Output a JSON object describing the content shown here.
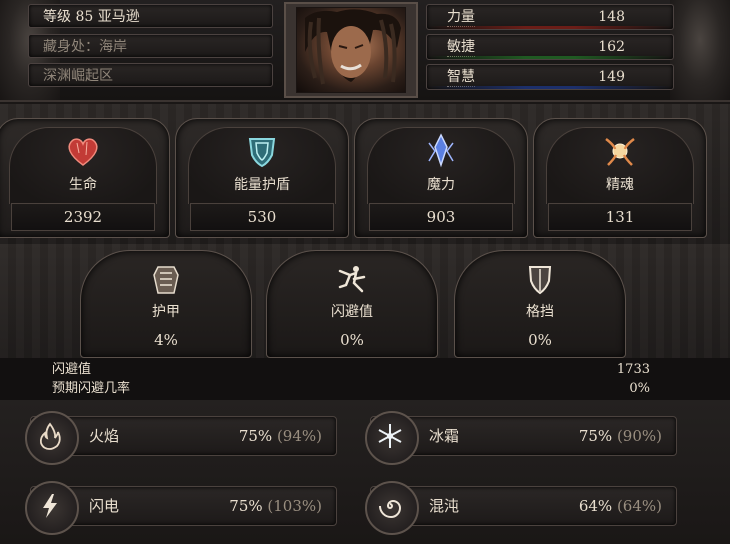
{
  "header": {
    "level_line": "等级 85 亚马逊",
    "hideout_line": "藏身处：海岸",
    "league_line": "深渊崛起区"
  },
  "attributes": [
    {
      "name": "力量",
      "value": "148",
      "bar_color": "#6b1d17"
    },
    {
      "name": "敏捷",
      "value": "162",
      "bar_color": "#1f5a22"
    },
    {
      "name": "智慧",
      "value": "149",
      "bar_color": "#1c2f6b"
    }
  ],
  "resources": [
    {
      "label": "生命",
      "value": "2392",
      "icon": "heart-icon"
    },
    {
      "label": "能量护盾",
      "value": "530",
      "icon": "energy-shield-icon"
    },
    {
      "label": "魔力",
      "value": "903",
      "icon": "mana-crystal-icon"
    },
    {
      "label": "精魂",
      "value": "131",
      "icon": "spirit-orb-icon"
    }
  ],
  "defenses": [
    {
      "label": "护甲",
      "value": "4%",
      "icon": "armour-icon"
    },
    {
      "label": "闪避值",
      "value": "0%",
      "icon": "evasion-icon"
    },
    {
      "label": "格挡",
      "value": "0%",
      "icon": "block-shield-icon"
    }
  ],
  "evasion_details": [
    {
      "key": "闪避值",
      "value": "1733"
    },
    {
      "key": "预期闪避几率",
      "value": "0%"
    }
  ],
  "resistances": [
    {
      "name": "火焰",
      "value": "75%",
      "max": "(94%)",
      "icon": "fire-icon"
    },
    {
      "name": "冰霜",
      "value": "75%",
      "max": "(90%)",
      "icon": "snowflake-icon"
    },
    {
      "name": "闪电",
      "value": "75%",
      "max": "(103%)",
      "icon": "lightning-icon"
    },
    {
      "name": "混沌",
      "value": "64%",
      "max": "(64%)",
      "icon": "chaos-spiral-icon"
    }
  ],
  "colors": {
    "fire": "#c6542e",
    "cold": "#bcd6e8",
    "lightning": "#e6d27a",
    "chaos": "#b8a9c8",
    "life": "#d2433e",
    "energy_shield": "#6fb9c4",
    "mana": "#5b7ee0",
    "spirit": "#e8b870"
  }
}
